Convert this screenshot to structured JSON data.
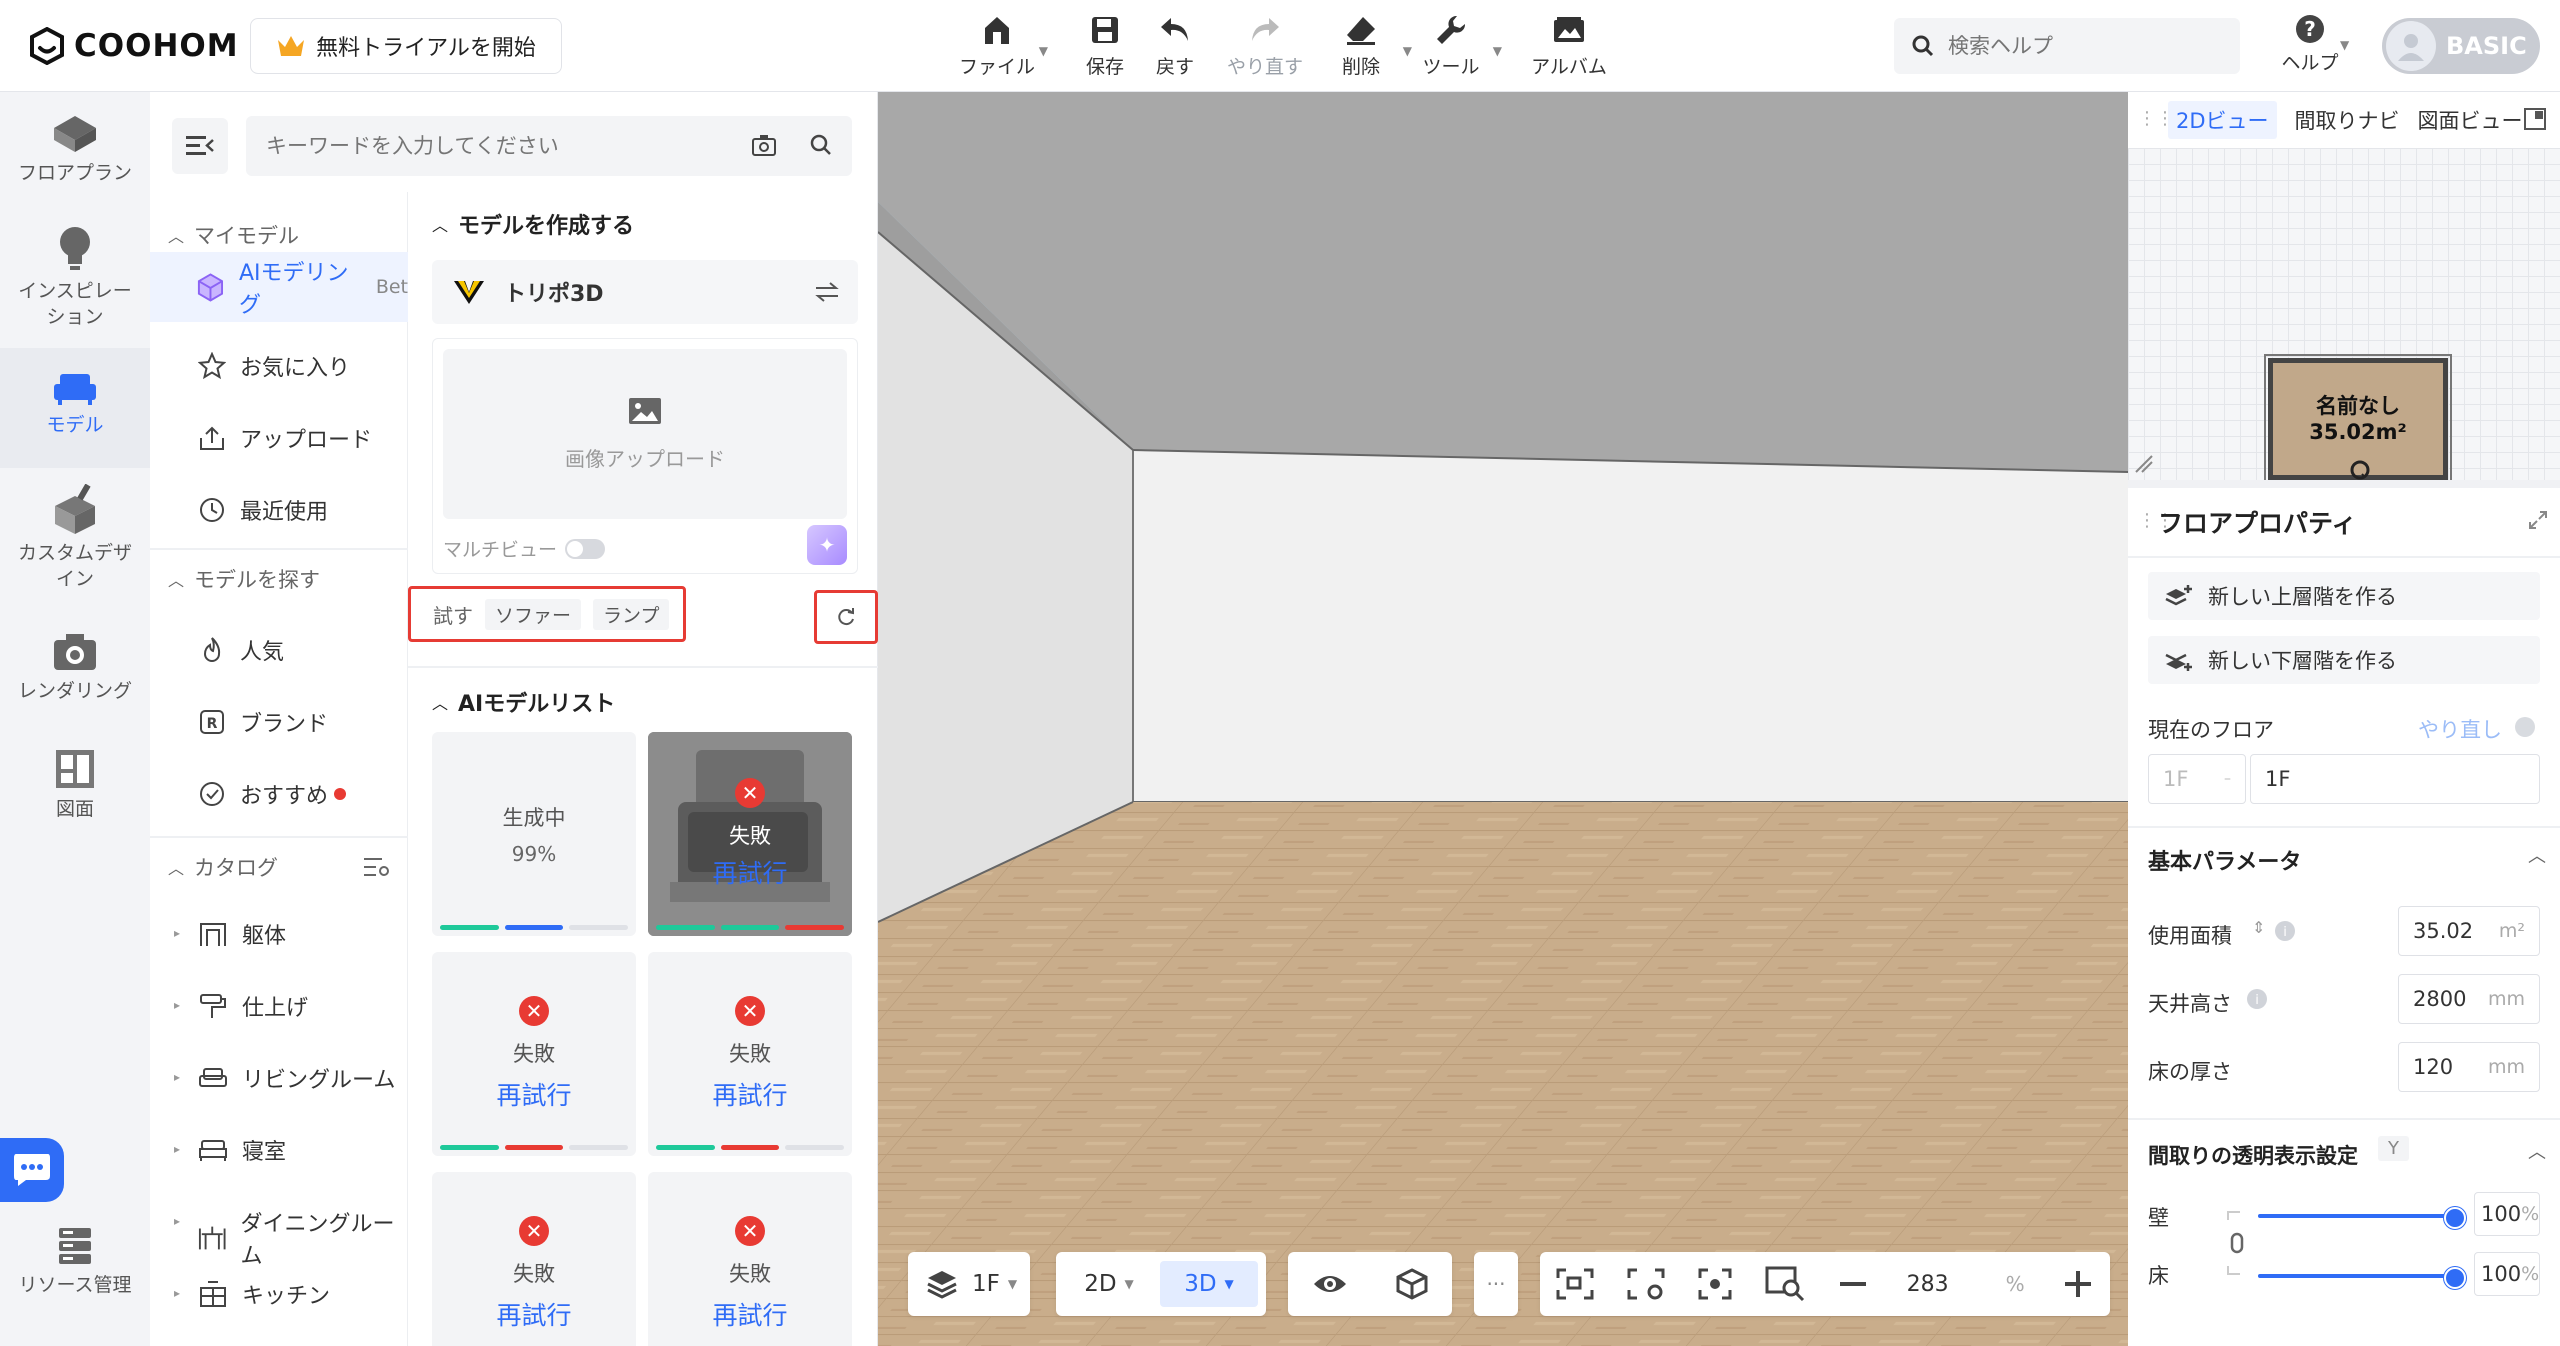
{
  "app": {
    "logo_text": "COOHOM",
    "trial_button": "無料トライアルを開始"
  },
  "toolbar": {
    "file": "ファイル",
    "save": "保存",
    "undo": "戻す",
    "redo": "やり直す",
    "delete": "削除",
    "tools": "ツール",
    "album": "アルバム"
  },
  "header": {
    "search_placeholder": "検索ヘルプ",
    "help": "ヘルプ",
    "plan": "BASIC"
  },
  "rail": {
    "floorplan": "フロアプラン",
    "inspiration": "インスピレーション",
    "model": "モデル",
    "custom": "カスタムデザイン",
    "rendering": "レンダリング",
    "drawing": "図面",
    "resources": "リソース管理"
  },
  "panel": {
    "keyword_placeholder": "キーワードを入力してください",
    "my_models": "マイモデル",
    "ai_modeling": "AIモデリング",
    "ai_badge": "Bet",
    "favorites": "お気に入り",
    "upload": "アップロード",
    "recent": "最近使用",
    "find_models": "モデルを探す",
    "popular": "人気",
    "brand": "ブランド",
    "recommended": "おすすめ",
    "catalog": "カタログ",
    "catalog_items": [
      "躯体",
      "仕上げ",
      "リビングルーム",
      "寝室",
      "ダイニングルーム",
      "キッチン"
    ]
  },
  "create": {
    "heading": "モデルを作成する",
    "engine": "トリポ3D",
    "upload_image": "画像アップロード",
    "multiview": "マルチビュー",
    "try_label": "試す",
    "try_chips": [
      "ソファー",
      "ランプ"
    ],
    "list_heading": "AIモデルリスト"
  },
  "cards": [
    {
      "status": "生成中",
      "progress": "99%"
    },
    {
      "status": "失敗",
      "retry": "再試行"
    },
    {
      "status": "失敗",
      "retry": "再試行"
    },
    {
      "status": "失敗",
      "retry": "再試行"
    },
    {
      "status": "失敗",
      "retry": "再試行"
    },
    {
      "status": "失敗",
      "retry": "再試行"
    }
  ],
  "bottom": {
    "floor": "1F",
    "mode_2d": "2D",
    "mode_3d": "3D",
    "more": "···",
    "zoom": "283",
    "zoom_unit": "%"
  },
  "minimap": {
    "tab_2d": "2Dビュー",
    "tab_nav": "間取りナビ",
    "tab_drawing": "図面ビュー",
    "room_name": "名前なし",
    "room_area": "35.02m²"
  },
  "props": {
    "title": "フロアプロパティ",
    "new_upper": "新しい上層階を作る",
    "new_lower": "新しい下層階を作る",
    "current_floor": "現在のフロア",
    "redo": "やり直し",
    "floor_prefix": "1F",
    "floor_value": "1F",
    "basic_params": "基本パラメータ",
    "area_label": "使用面積",
    "area_value": "35.02",
    "area_unit": "m²",
    "ceiling_label": "天井高さ",
    "ceiling_value": "2800",
    "ceiling_unit": "mm",
    "floor_thick_label": "床の厚さ",
    "floor_thick_value": "120",
    "floor_thick_unit": "mm",
    "transparency": "間取りの透明表示設定",
    "transparency_tag": "Y",
    "wall": "壁",
    "wall_value": "100",
    "floor_label": "床",
    "floor_value2": "100",
    "percent": "%"
  },
  "colors": {
    "accent": "#2f6cf6",
    "danger": "#e83a33",
    "success": "#1ec99a"
  }
}
